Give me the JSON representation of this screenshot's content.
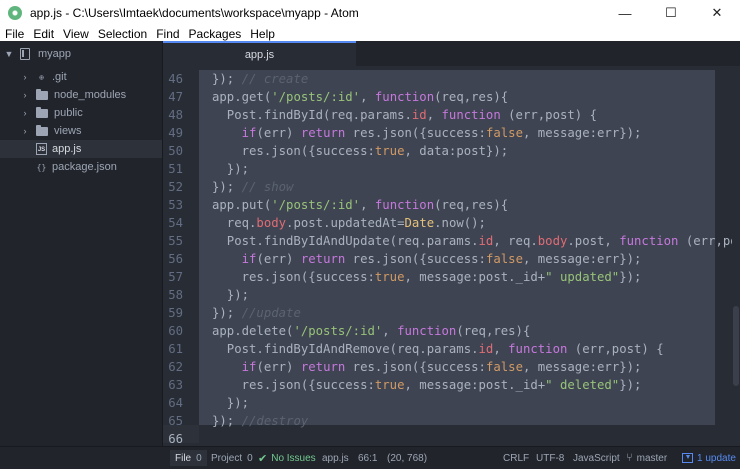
{
  "window": {
    "title": "app.js - C:\\Users\\Imtaek\\documents\\workspace\\myapp - Atom",
    "minimize_glyph": "—",
    "maximize_glyph": "☐",
    "close_glyph": "✕"
  },
  "menu": [
    "File",
    "Edit",
    "View",
    "Selection",
    "Find",
    "Packages",
    "Help"
  ],
  "tree": {
    "root": "myapp",
    "items": [
      {
        "label": ".git",
        "type": "folder",
        "icon": "git-icon"
      },
      {
        "label": "node_modules",
        "type": "folder",
        "icon": "folder-icon"
      },
      {
        "label": "public",
        "type": "folder",
        "icon": "folder-icon"
      },
      {
        "label": "views",
        "type": "folder",
        "icon": "folder-icon"
      },
      {
        "label": "app.js",
        "type": "file",
        "icon": "js-file-icon",
        "selected": true
      },
      {
        "label": "package.json",
        "type": "file",
        "icon": "json-file-icon"
      }
    ]
  },
  "tabs": [
    {
      "label": "app.js",
      "active": true
    }
  ],
  "code": {
    "line_numbers": [
      "46",
      "47",
      "48",
      "49",
      "50",
      "51",
      "52",
      "53",
      "54",
      "55",
      "56",
      "57",
      "58",
      "59",
      "60",
      "61",
      "62",
      "63",
      "64",
      "65",
      "66"
    ],
    "current_line": "66"
  },
  "status": {
    "file_tab_label": "File",
    "file_tab_count": "0",
    "project_tab_label": "Project",
    "project_tab_count": "0",
    "issues": "No Issues",
    "filename": "app.js",
    "cursor": "66:1",
    "selection": "(20, 768)",
    "line_ending": "CRLF",
    "encoding": "UTF-8",
    "grammar": "JavaScript",
    "branch": "master",
    "update": "1 update"
  },
  "colors": {
    "accent": "#568af2",
    "editor_bg": "#282c34",
    "selection_bg": "#3e4451",
    "sidebar_bg": "#21252b"
  }
}
